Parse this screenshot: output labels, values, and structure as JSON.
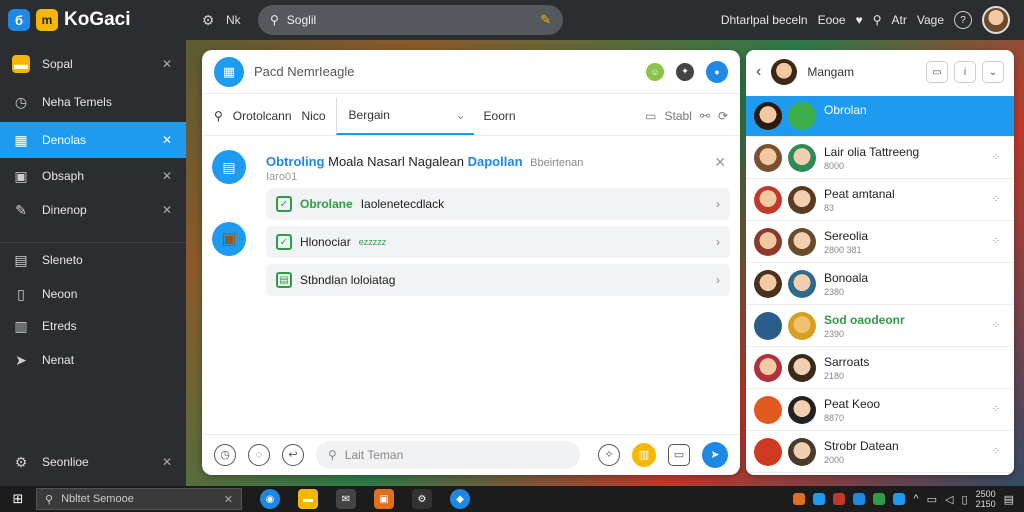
{
  "topbar": {
    "badge": "б",
    "logo": "m",
    "brand": "KoGaci",
    "nk": "Nk",
    "search": "Soglil",
    "right_text": "Dhtarlpal beceln",
    "right_text2": "Eooe",
    "right_text3": "Atr",
    "right_text4": "Vage"
  },
  "sidebar": {
    "items": [
      {
        "label": "Sopal"
      },
      {
        "label": "Neha Temels"
      },
      {
        "label": "Denolas"
      },
      {
        "label": "Obsaph"
      },
      {
        "label": "Dinenop"
      },
      {
        "label": "Sleneto"
      },
      {
        "label": "Neoon"
      },
      {
        "label": "Etreds"
      },
      {
        "label": "Nenat"
      },
      {
        "label": "Seonlioe"
      }
    ]
  },
  "main": {
    "header_title": "Pacd NemrIeagle",
    "tabs": {
      "tab1": "Orotolcann",
      "tab2": "Nico",
      "select": "Bergain",
      "tab3": "Eoorn",
      "right": "Stabl"
    },
    "message": {
      "title_blue": "Obtroling",
      "title_rest": "Moala Nasarl Nagalean",
      "title_blue2": "Dapollan",
      "tag": "Bbeirtenan",
      "sub": "Iaro01"
    },
    "cards": [
      {
        "label_green": "Obrolane",
        "label_rest": "Iaolenetecdlack"
      },
      {
        "label_green": "",
        "label_rest": "Hlonociar",
        "small": "ezzzzz"
      },
      {
        "label_green": "",
        "label_rest": "Stbndlan loloiatag"
      }
    ],
    "input_placeholder": "Lait Teman"
  },
  "contacts": {
    "title": "Mangam",
    "rows": [
      {
        "name": "Obrolan",
        "meta": ""
      },
      {
        "name": "Lair olia Tattreeng",
        "meta": "8000"
      },
      {
        "name": "Peat amtanal",
        "meta": "83"
      },
      {
        "name": "Sereolia",
        "meta": "2800 381"
      },
      {
        "name": "Bonoala",
        "meta": "2380"
      },
      {
        "name": "Sod oaodeonr",
        "meta": "2390"
      },
      {
        "name": "Sarroats",
        "meta": "2180"
      },
      {
        "name": "Peat Keoo",
        "meta": "8870"
      },
      {
        "name": "Strobr Datean",
        "meta": "2000"
      }
    ]
  },
  "taskbar": {
    "search": "Nbltet Semooe",
    "clock_time": "2500",
    "clock_date": "2150"
  },
  "colors": {
    "accent": "#1e9bef",
    "sidebar_bg": "#2b2d31",
    "brand_yellow": "#f5b700",
    "green": "#2e9d48"
  }
}
